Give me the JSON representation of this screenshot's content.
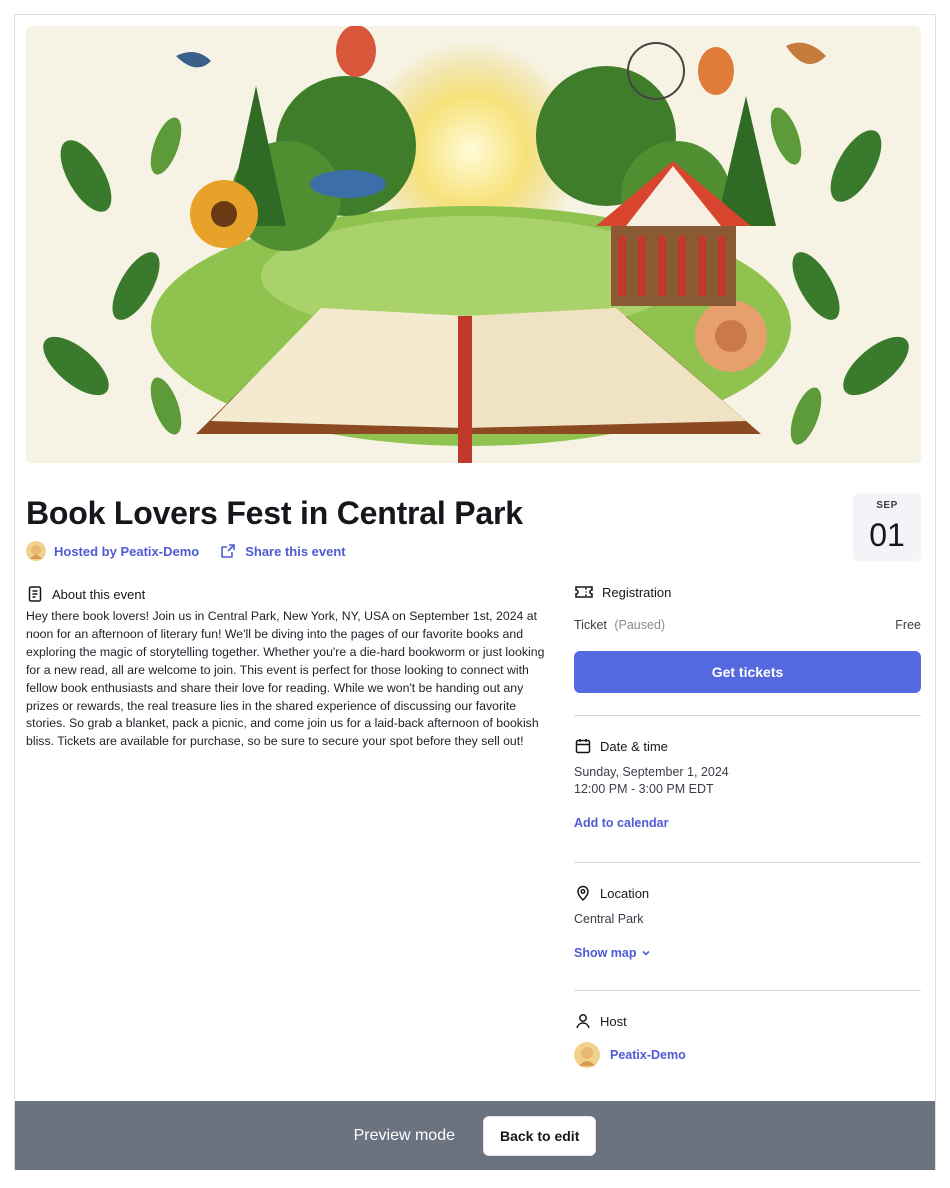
{
  "event": {
    "title": "Book Lovers Fest in Central Park",
    "host_link": "Hosted by Peatix-Demo",
    "share_link": "Share this event",
    "date_badge": {
      "month": "SEP",
      "day": "01"
    }
  },
  "about": {
    "heading": "About this event",
    "body": "Hey there book lovers! Join us in Central Park, New York, NY, USA on September 1st, 2024 at noon for an afternoon of literary fun! We'll be diving into the pages of our favorite books and exploring the magic of storytelling together. Whether you're a die-hard bookworm or just looking for a new read, all are welcome to join. This event is perfect for those looking to connect with fellow book enthusiasts and share their love for reading. While we won't be handing out any prizes or rewards, the real treasure lies in the shared experience of discussing our favorite stories. So grab a blanket, pack a picnic, and come join us for a laid-back afternoon of bookish bliss. Tickets are available for purchase, so be sure to secure your spot before they sell out!"
  },
  "registration": {
    "heading": "Registration",
    "ticket_label": "Ticket",
    "ticket_status": "(Paused)",
    "ticket_price": "Free",
    "button": "Get tickets"
  },
  "datetime": {
    "heading": "Date & time",
    "date": "Sunday, September 1, 2024",
    "time": "12:00 PM - 3:00 PM EDT",
    "add_calendar": "Add to calendar"
  },
  "location": {
    "heading": "Location",
    "name": "Central Park",
    "show_map": "Show map"
  },
  "host": {
    "heading": "Host",
    "name": "Peatix-Demo"
  },
  "preview": {
    "label": "Preview mode",
    "back_button": "Back to edit"
  },
  "colors": {
    "accent": "#5469df",
    "link": "#4f5bd5",
    "preview_bar": "#6b7280"
  }
}
